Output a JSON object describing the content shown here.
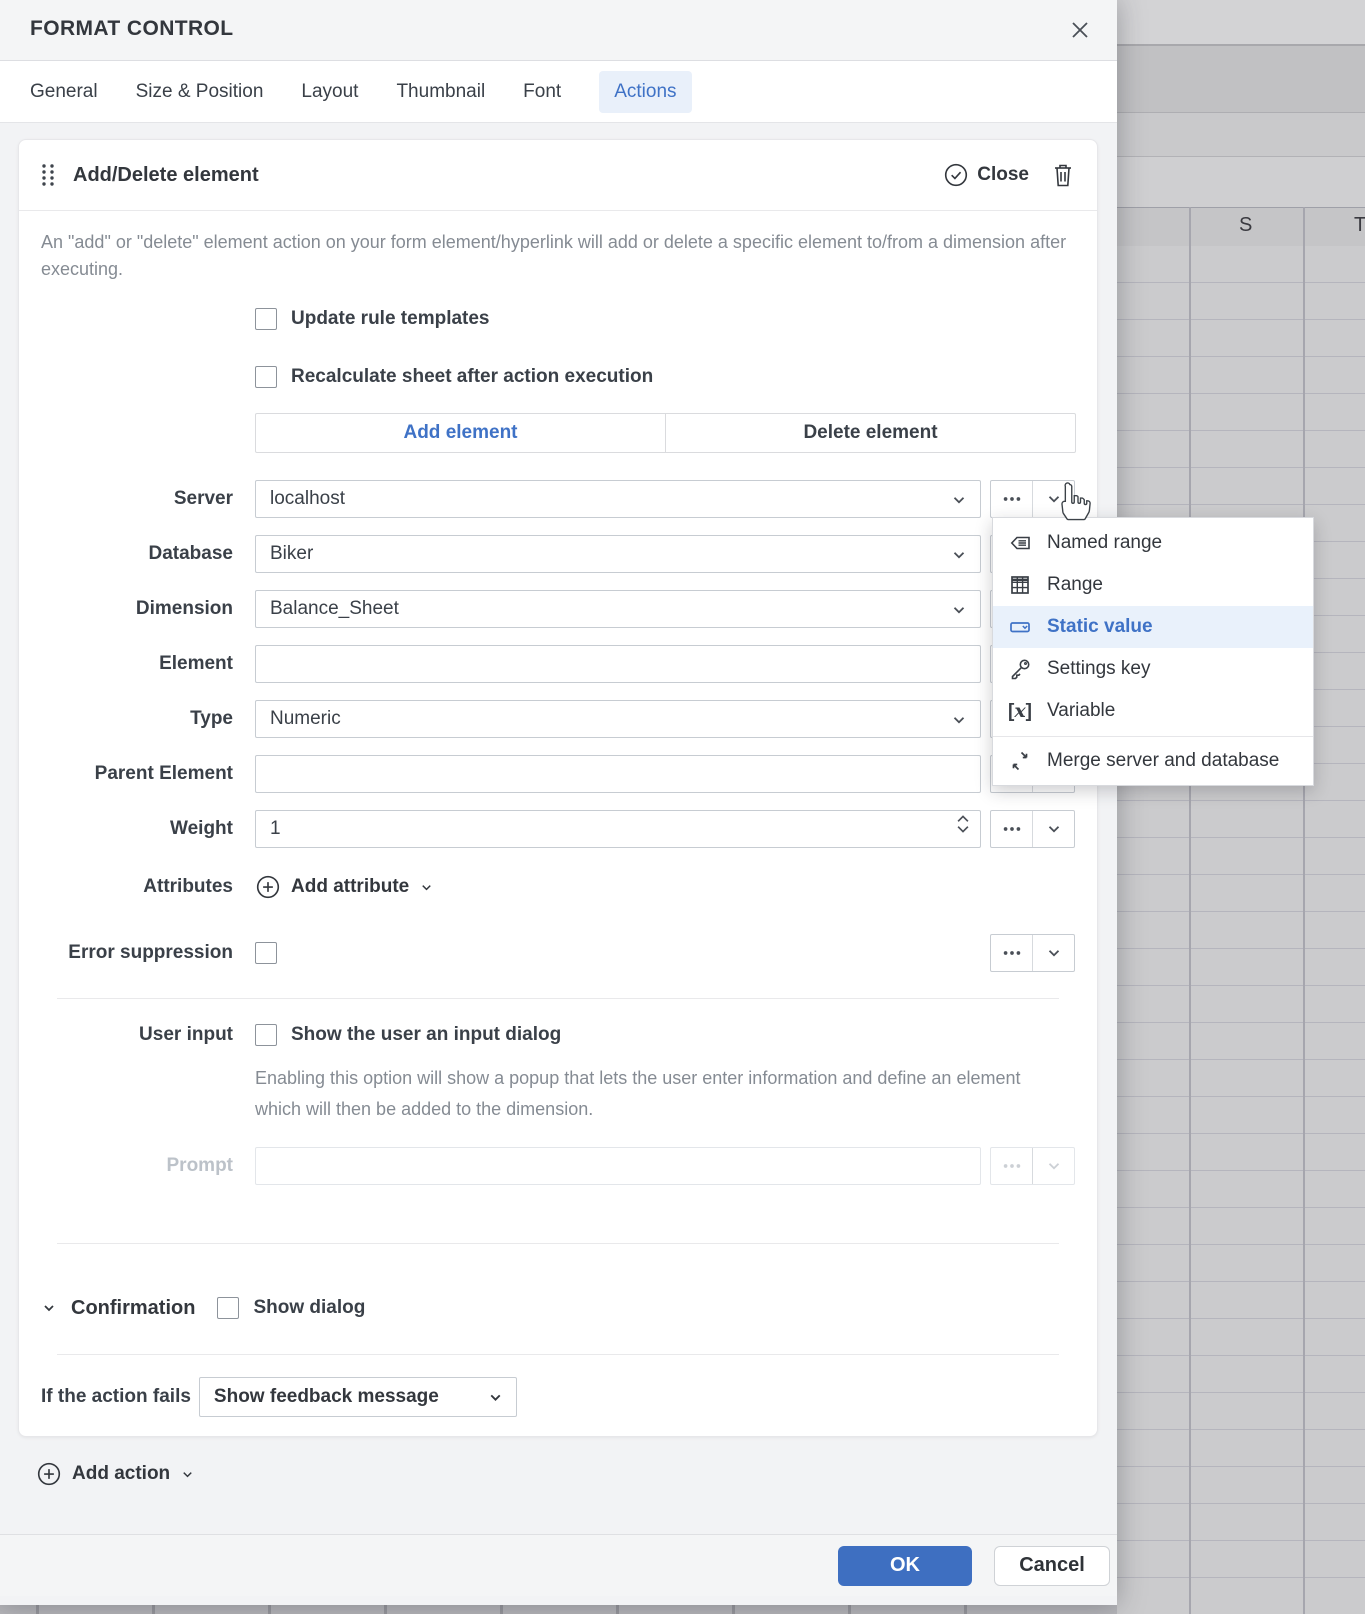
{
  "dialog": {
    "title": "FORMAT CONTROL",
    "tabs": [
      "General",
      "Size & Position",
      "Layout",
      "Thumbnail",
      "Font",
      "Actions"
    ],
    "active_tab": "Actions"
  },
  "card": {
    "title": "Add/Delete element",
    "close_label": "Close",
    "description": "An \"add\" or \"delete\" element action on your form element/hyperlink will add or delete a specific element to/from a dimension after executing.",
    "checkbox_update": "Update rule templates",
    "checkbox_recalculate": "Recalculate sheet after action execution",
    "mode_add": "Add element",
    "mode_delete": "Delete element",
    "fields": [
      {
        "label": "Server",
        "value": "localhost"
      },
      {
        "label": "Database",
        "value": "Biker"
      },
      {
        "label": "Dimension",
        "value": "Balance_Sheet"
      },
      {
        "label": "Element",
        "value": ""
      },
      {
        "label": "Type",
        "value": "Numeric"
      },
      {
        "label": "Parent Element",
        "value": ""
      },
      {
        "label": "Weight",
        "value": "1"
      }
    ],
    "attributes_label": "Attributes",
    "add_attribute_label": "Add attribute",
    "error_suppression_label": "Error suppression",
    "user_input_label": "User input",
    "user_input_checkbox": "Show the user an input dialog",
    "user_input_description": "Enabling this option will show a popup that lets the user enter information and define an element which will then be added to the dimension.",
    "prompt_label": "Prompt",
    "prompt_value": "",
    "confirmation_label": "Confirmation",
    "confirmation_checkbox": "Show dialog",
    "fail_label": "If the action fails",
    "fail_value": "Show feedback message"
  },
  "context_menu": {
    "items": [
      {
        "label": "Named range"
      },
      {
        "label": "Range"
      },
      {
        "label": "Static value"
      },
      {
        "label": "Settings key"
      },
      {
        "label": "Variable"
      },
      {
        "label": "Merge server and database"
      }
    ],
    "active_item": "Static value"
  },
  "footer": {
    "add_action_label": "Add action",
    "ok_label": "OK",
    "cancel_label": "Cancel"
  },
  "spreadsheet": {
    "visible_columns": [
      "S",
      "T"
    ]
  },
  "colors": {
    "accent": "#3f72c6",
    "accent_bg": "#e9f1fb",
    "ok_button": "#3e6fc1"
  }
}
